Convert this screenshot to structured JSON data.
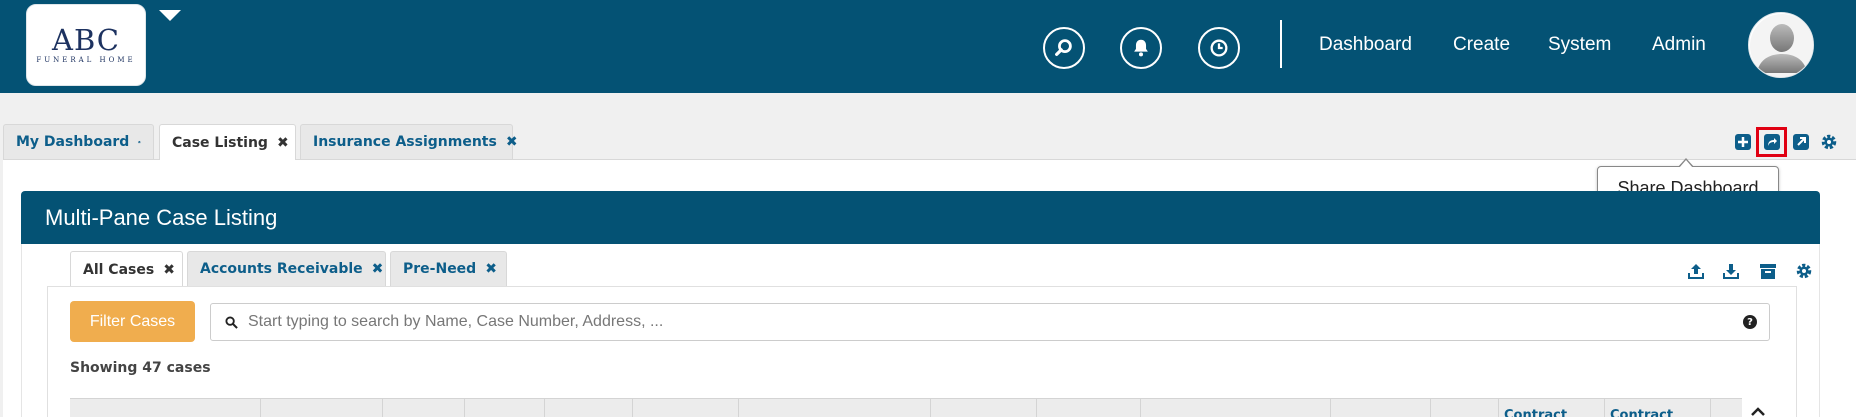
{
  "logo": {
    "main": "ABC",
    "sub": "Funeral Home"
  },
  "nav": {
    "icons": [
      "search-icon",
      "bell-icon",
      "clock-icon"
    ],
    "links": [
      "Dashboard",
      "Create",
      "System",
      "Admin"
    ]
  },
  "tabs": [
    {
      "label": "My Dashboard",
      "icon": "home-icon"
    },
    {
      "label": "Case Listing",
      "close": "✖"
    },
    {
      "label": "Insurance Assignments",
      "close": "✖"
    }
  ],
  "toolbar": {
    "icons": [
      "add-icon",
      "share-icon",
      "external-link-icon",
      "gear-icon"
    ],
    "tooltip": "Share Dashboard"
  },
  "widget": {
    "title": "Multi-Pane Case Listing",
    "tabs": [
      {
        "label": "All Cases",
        "close": "✖"
      },
      {
        "label": "Accounts Receivable",
        "close": "✖"
      },
      {
        "label": "Pre-Need",
        "close": "✖"
      }
    ],
    "tool_icons": [
      "upload-icon",
      "download-icon",
      "archive-icon",
      "gear-icon"
    ],
    "filter_label": "Filter Cases",
    "search_placeholder": "Start typing to search by Name, Case Number, Address, ...",
    "help": "?",
    "showing": "Showing 47 cases",
    "columns": [
      "Contract",
      "Contract"
    ]
  },
  "colors": {
    "primary": "#045274",
    "link": "#0d5e8a",
    "filter": "#f0ad4e",
    "highlight": "#e00012"
  }
}
